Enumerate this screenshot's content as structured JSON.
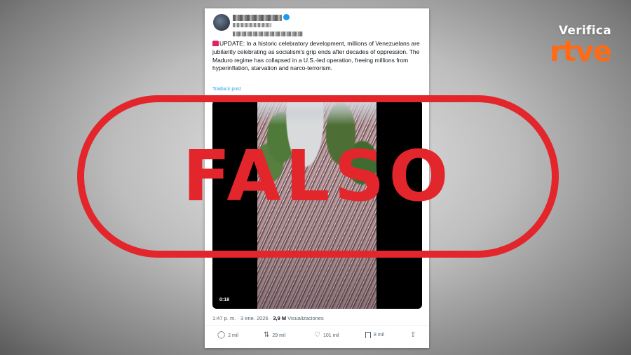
{
  "brand": {
    "top": "Verifica",
    "logo": "rtve",
    "accent": "#ff6a13"
  },
  "post": {
    "body_label": "UPDATE: In a historic celebratory development, millions of Venezuelans are jubilantly celebrating as socialism's grip ends after decades of oppression. The Maduro regime has collapsed in a U.S.-led operation, freeing millions from hyperinflation, starvation and narco-terrorism.",
    "translate": "Traducir post",
    "video_time": "0:18",
    "meta_prefix": "1:47 p. m. · 3 ene. 2026 · ",
    "views_count": "3,9 M",
    "views_label": " Visualizaciones"
  },
  "actions": {
    "replies": "2 mil",
    "reposts": "29 mil",
    "likes": "101 mil",
    "bookmarks": "8 mil"
  },
  "stamp": {
    "text": "FALSO",
    "color": "#e3262b"
  },
  "icons": [
    "siren-icon",
    "verified-badge-icon",
    "reply-icon",
    "repost-icon",
    "like-icon",
    "bookmark-icon",
    "share-icon"
  ]
}
